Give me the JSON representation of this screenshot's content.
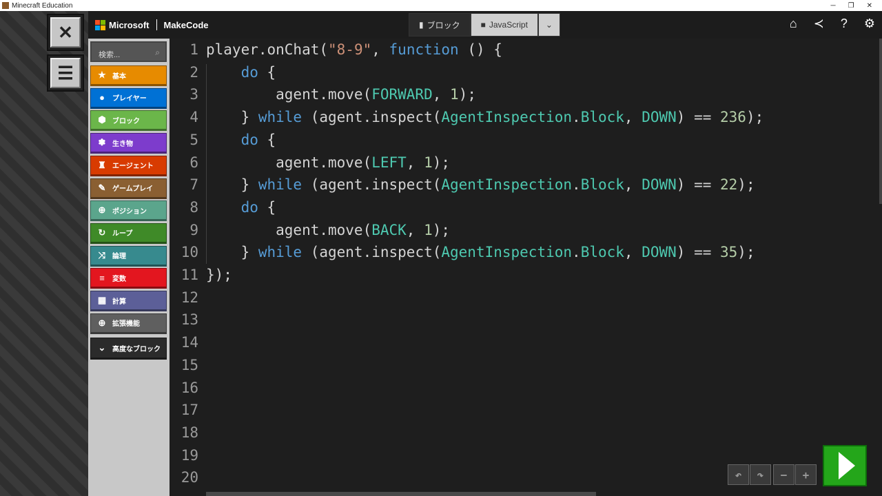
{
  "window": {
    "title": "Minecraft Education"
  },
  "header": {
    "brand": "Microsoft",
    "product": "MakeCode",
    "tab_blocks": "ブロック",
    "tab_js": "JavaScript",
    "ms_colors": [
      "#f25022",
      "#7fba00",
      "#00a4ef",
      "#ffb900"
    ]
  },
  "toolbox": {
    "search_placeholder": "検索...",
    "categories": [
      {
        "label": "基本",
        "icon": "star",
        "color": "#e78b00"
      },
      {
        "label": "プレイヤー",
        "icon": "person",
        "color": "#0071d5"
      },
      {
        "label": "ブロック",
        "icon": "cube",
        "color": "#6bb64a"
      },
      {
        "label": "生き物",
        "icon": "paw",
        "color": "#7d3ccc"
      },
      {
        "label": "エージェント",
        "icon": "agent",
        "color": "#d83b01"
      },
      {
        "label": "ゲームプレイ",
        "icon": "wrench",
        "color": "#8a5f32"
      },
      {
        "label": "ポジション",
        "icon": "crosshair",
        "color": "#5ba58c"
      },
      {
        "label": "ループ",
        "icon": "loop",
        "color": "#3f8a28"
      },
      {
        "label": "論理",
        "icon": "shuffle",
        "color": "#378a8e"
      },
      {
        "label": "変数",
        "icon": "list",
        "color": "#e3161f"
      },
      {
        "label": "計算",
        "icon": "calculator",
        "color": "#5c5f98"
      },
      {
        "label": "拡張機能",
        "icon": "plus-circle",
        "color": "#5f5f5f"
      },
      {
        "label": "高度なブロック",
        "icon": "chevron-down",
        "color": "#2b2b2b"
      }
    ]
  },
  "editor": {
    "line_numbers": [
      "1",
      "2",
      "3",
      "4",
      "5",
      "6",
      "7",
      "8",
      "9",
      "10",
      "11",
      "12",
      "13",
      "14",
      "15",
      "16",
      "17",
      "18",
      "19",
      "20"
    ],
    "lines": [
      [
        [
          "id",
          "player.onChat("
        ],
        [
          "str",
          "\"8-9\""
        ],
        [
          "id",
          ", "
        ],
        [
          "kw",
          "function"
        ],
        [
          "id",
          " () {"
        ]
      ],
      [
        [
          "id",
          "    "
        ],
        [
          "kw",
          "do"
        ],
        [
          "id",
          " {"
        ]
      ],
      [
        [
          "id",
          "        agent.move("
        ],
        [
          "type",
          "FORWARD"
        ],
        [
          "id",
          ", "
        ],
        [
          "num",
          "1"
        ],
        [
          "id",
          ");"
        ]
      ],
      [
        [
          "id",
          "    } "
        ],
        [
          "kw",
          "while"
        ],
        [
          "id",
          " (agent.inspect("
        ],
        [
          "type",
          "AgentInspection"
        ],
        [
          "id",
          "."
        ],
        [
          "type",
          "Block"
        ],
        [
          "id",
          ", "
        ],
        [
          "type",
          "DOWN"
        ],
        [
          "id",
          ") == "
        ],
        [
          "num",
          "236"
        ],
        [
          "id",
          ");"
        ]
      ],
      [
        [
          "id",
          "    "
        ],
        [
          "kw",
          "do"
        ],
        [
          "id",
          " {"
        ]
      ],
      [
        [
          "id",
          "        agent.move("
        ],
        [
          "type",
          "LEFT"
        ],
        [
          "id",
          ", "
        ],
        [
          "num",
          "1"
        ],
        [
          "id",
          ");"
        ]
      ],
      [
        [
          "id",
          "    } "
        ],
        [
          "kw",
          "while"
        ],
        [
          "id",
          " (agent.inspect("
        ],
        [
          "type",
          "AgentInspection"
        ],
        [
          "id",
          "."
        ],
        [
          "type",
          "Block"
        ],
        [
          "id",
          ", "
        ],
        [
          "type",
          "DOWN"
        ],
        [
          "id",
          ") == "
        ],
        [
          "num",
          "22"
        ],
        [
          "id",
          ");"
        ]
      ],
      [
        [
          "id",
          "    "
        ],
        [
          "kw",
          "do"
        ],
        [
          "id",
          " {"
        ]
      ],
      [
        [
          "id",
          "        agent.move("
        ],
        [
          "type",
          "BACK"
        ],
        [
          "id",
          ", "
        ],
        [
          "num",
          "1"
        ],
        [
          "id",
          ");"
        ]
      ],
      [
        [
          "id",
          "    } "
        ],
        [
          "kw",
          "while"
        ],
        [
          "id",
          " (agent.inspect("
        ],
        [
          "type",
          "AgentInspection"
        ],
        [
          "id",
          "."
        ],
        [
          "type",
          "Block"
        ],
        [
          "id",
          ", "
        ],
        [
          "type",
          "DOWN"
        ],
        [
          "id",
          ") == "
        ],
        [
          "num",
          "35"
        ],
        [
          "id",
          ");"
        ]
      ],
      [
        [
          "id",
          "});"
        ]
      ]
    ]
  }
}
